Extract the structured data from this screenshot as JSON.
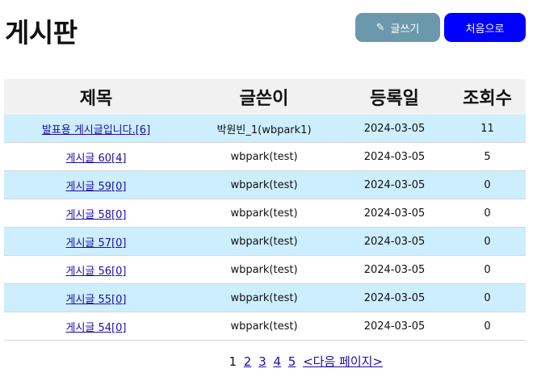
{
  "page": {
    "title": "게시판"
  },
  "buttons": {
    "write_label": "글쓰기",
    "home_label": "처음으로"
  },
  "table": {
    "headers": [
      "제목",
      "글쓴이",
      "등록일",
      "조회수"
    ],
    "rows": [
      {
        "title": "발표용 게시글입니다.[6]",
        "author": "박원빈_1(wbpark1)",
        "date": "2024-03-05",
        "views": "11"
      },
      {
        "title": "게시글 60[4]",
        "author": "wbpark(test)",
        "date": "2024-03-05",
        "views": "5"
      },
      {
        "title": "게시글 59[0]",
        "author": "wbpark(test)",
        "date": "2024-03-05",
        "views": "0"
      },
      {
        "title": "게시글 58[0]",
        "author": "wbpark(test)",
        "date": "2024-03-05",
        "views": "0"
      },
      {
        "title": "게시글 57[0]",
        "author": "wbpark(test)",
        "date": "2024-03-05",
        "views": "0"
      },
      {
        "title": "게시글 56[0]",
        "author": "wbpark(test)",
        "date": "2024-03-05",
        "views": "0"
      },
      {
        "title": "게시글 55[0]",
        "author": "wbpark(test)",
        "date": "2024-03-05",
        "views": "0"
      },
      {
        "title": "게시글 54[0]",
        "author": "wbpark(test)",
        "date": "2024-03-05",
        "views": "0"
      }
    ]
  },
  "pagination": {
    "current": "1",
    "pages": [
      "2",
      "3",
      "4",
      "5"
    ],
    "next_label": "<다음 페이지>"
  },
  "colors": {
    "write_button": "#6b99ab",
    "home_button": "#0000ff",
    "row_highlight": "#cdeefe",
    "header_bg": "#f1f1f1"
  }
}
